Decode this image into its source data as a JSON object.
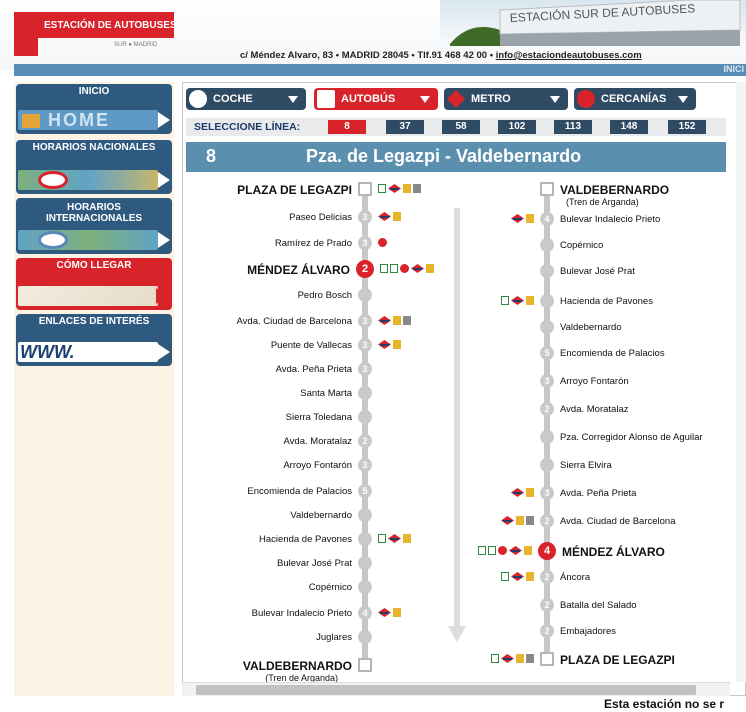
{
  "header": {
    "logo_title": "ESTACIÓN DE AUTOBUSES",
    "logo_sub": "SUR ● MADRID",
    "building_sign": "ESTACIÓN SUR DE AUTOBUSES",
    "address": "c/ Méndez Alvaro, 83 • MADRID 28045 • Tlf.91 468 42 00 • ",
    "email": "info@estaciondeautobuses.com",
    "inicio_top": "INICI"
  },
  "sidebar": {
    "items": [
      {
        "label": "INICIO",
        "image_text": "HOME"
      },
      {
        "label": "HORARIOS NACIONALES"
      },
      {
        "label": "HORARIOS INTERNACIONALES"
      },
      {
        "label": "CÓMO LLEGAR"
      },
      {
        "label": "ENLACES DE INTERÉS",
        "image_text": "WWW."
      }
    ]
  },
  "transport_tabs": [
    {
      "label": "COCHE",
      "color": "#2f4a63"
    },
    {
      "label": "AUTOBÚS",
      "color": "#d8232a"
    },
    {
      "label": "METRO",
      "color": "#2f4a63"
    },
    {
      "label": "CERCANÍAS",
      "color": "#2f4a63"
    }
  ],
  "line_selector": {
    "label": "SELECCIONE LÍNEA:",
    "lines": [
      "8",
      "37",
      "58",
      "102",
      "113",
      "148",
      "152"
    ],
    "selected": "8"
  },
  "route": {
    "number": "8",
    "name": "Pza. de Legazpi - Valdebernardo"
  },
  "left_stops": [
    {
      "name": "PLAZA DE LEGAZPI",
      "big": true,
      "marker": "term",
      "conns": [
        "bus",
        "metro",
        "lnum",
        "lnum"
      ]
    },
    {
      "name": "Paseo Delicias",
      "marker": "3",
      "conns": [
        "metro",
        "lnum"
      ]
    },
    {
      "name": "Ramírez de Prado",
      "marker": "3",
      "conns": [
        "cer"
      ]
    },
    {
      "name": "MÉNDEZ ÁLVARO",
      "big": true,
      "marker": "2",
      "hub": true,
      "conns": [
        "bus",
        "bus",
        "cer",
        "metro",
        "lnum"
      ]
    },
    {
      "name": "Pedro Bosch",
      "marker": "",
      "conns": []
    },
    {
      "name": "Avda. Ciudad de Barcelona",
      "marker": "3",
      "conns": [
        "metro",
        "lnum",
        "lnum"
      ]
    },
    {
      "name": "Puente de Vallecas",
      "marker": "3",
      "conns": [
        "metro",
        "lnum"
      ]
    },
    {
      "name": "Avda. Peña Prieta",
      "marker": "3",
      "conns": []
    },
    {
      "name": "Santa Marta",
      "marker": "",
      "conns": []
    },
    {
      "name": "Sierra Toledana",
      "marker": "",
      "conns": []
    },
    {
      "name": "Avda. Moratalaz",
      "marker": "2",
      "conns": []
    },
    {
      "name": "Arroyo Fontarón",
      "marker": "3",
      "conns": []
    },
    {
      "name": "Encomienda de Palacios",
      "marker": "5",
      "conns": []
    },
    {
      "name": "Valdebernardo",
      "marker": "",
      "conns": []
    },
    {
      "name": "Hacienda de Pavones",
      "marker": "",
      "conns": [
        "bus",
        "metro",
        "lnum"
      ]
    },
    {
      "name": "Bulevar José Prat",
      "marker": "",
      "conns": []
    },
    {
      "name": "Copérnico",
      "marker": "",
      "conns": []
    },
    {
      "name": "Bulevar Indalecio Prieto",
      "marker": "4",
      "conns": [
        "metro",
        "lnum"
      ]
    },
    {
      "name": "Juglares",
      "marker": "",
      "conns": []
    },
    {
      "name": "VALDEBERNARDO",
      "big": true,
      "marker": "term",
      "sub": "(Tren de Arganda)",
      "conns": []
    }
  ],
  "right_stops": [
    {
      "name": "VALDEBERNARDO",
      "big": true,
      "marker": "term",
      "sub": "(Tren de Arganda)",
      "conns": []
    },
    {
      "name": "Bulevar Indalecio Prieto",
      "marker": "4",
      "conns": [
        "metro",
        "lnum"
      ]
    },
    {
      "name": "Copérnico",
      "marker": "",
      "conns": []
    },
    {
      "name": "Bulevar José Prat",
      "marker": "",
      "conns": []
    },
    {
      "name": "Hacienda de Pavones",
      "marker": "",
      "conns": [
        "bus",
        "metro",
        "lnum"
      ]
    },
    {
      "name": "Valdebernardo",
      "marker": "",
      "conns": []
    },
    {
      "name": "Encomienda de Palacios",
      "marker": "5",
      "conns": []
    },
    {
      "name": "Arroyo Fontarón",
      "marker": "3",
      "conns": []
    },
    {
      "name": "Avda. Moratalaz",
      "marker": "2",
      "conns": []
    },
    {
      "name": "Pza. Corregidor Alonso de Aguilar",
      "marker": "",
      "conns": []
    },
    {
      "name": "Sierra Elvira",
      "marker": "",
      "conns": []
    },
    {
      "name": "Avda. Peña Prieta",
      "marker": "3",
      "conns": [
        "metro",
        "lnum"
      ]
    },
    {
      "name": "Avda. Ciudad de Barcelona",
      "marker": "2",
      "conns": [
        "metro",
        "lnum",
        "lnum"
      ]
    },
    {
      "name": "MÉNDEZ ÁLVARO",
      "big": true,
      "marker": "4",
      "hub": true,
      "conns": [
        "bus",
        "bus",
        "cer",
        "metro",
        "lnum"
      ]
    },
    {
      "name": "Áncora",
      "marker": "2",
      "conns": [
        "bus",
        "metro",
        "lnum"
      ]
    },
    {
      "name": "Batalla del Salado",
      "marker": "2",
      "conns": []
    },
    {
      "name": "Embajadores",
      "marker": "2",
      "conns": []
    },
    {
      "name": "PLAZA DE LEGAZPI",
      "big": true,
      "marker": "term",
      "conns": [
        "bus",
        "metro",
        "lnum",
        "lnum"
      ]
    }
  ],
  "footer_note": "Esta estación no se r",
  "colors": {
    "accent_red": "#d8232a",
    "navy": "#2f4a63",
    "title_blue": "#5b8fae",
    "sidebar_bg": "#fdf3e5"
  }
}
